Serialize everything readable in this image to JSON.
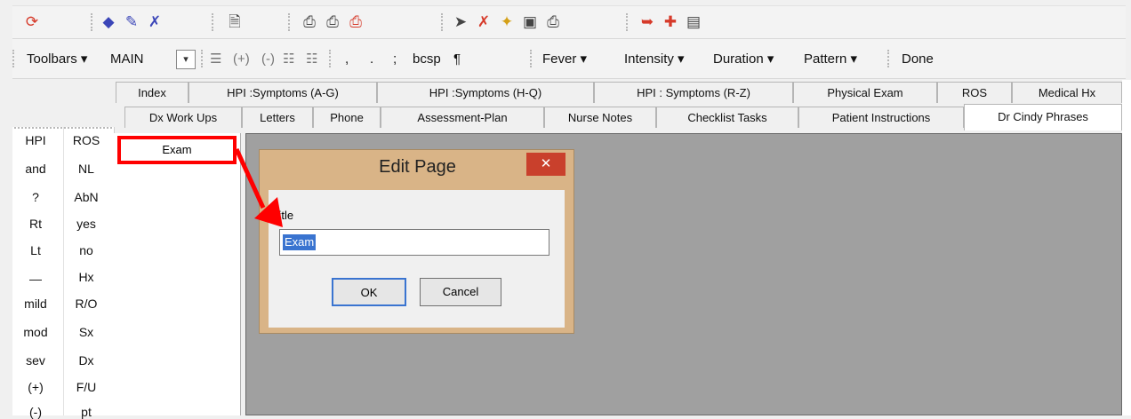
{
  "toolbar1": {
    "icons": [
      "refresh-icon",
      "bookmark-icon",
      "book-icon",
      "erase-icon",
      "document-icon",
      "print-icon",
      "print-preview-icon",
      "print-setup-icon",
      "send-icon",
      "stop-icon",
      "star-icon",
      "config-icon",
      "printer-icon",
      "export-icon",
      "add-record-icon",
      "merge-icon"
    ]
  },
  "toolbar2": {
    "toolbars_label": "Toolbars ▾",
    "toolbars_value": "MAIN",
    "combo_arrow": "▾",
    "list_icon": "☰",
    "plus": "(+)",
    "minus": "(-)",
    "bullet_icon": "☷",
    "number_icon": "☷",
    "comma": ",",
    "period": ".",
    "semicolon": ";",
    "bcsp": "bcsp",
    "pilcrow": "¶",
    "fever": "Fever ▾",
    "intensity": "Intensity ▾",
    "duration": "Duration ▾",
    "pattern": "Pattern ▾",
    "done": "Done"
  },
  "tabs_row1": [
    "Index",
    "HPI :Symptoms (A-G)",
    "HPI :Symptoms (H-Q)",
    "HPI : Symptoms (R-Z)",
    "Physical Exam",
    "ROS",
    "Medical Hx"
  ],
  "tabs_row2": [
    "Dx Work Ups",
    "Letters",
    "Phone",
    "Assessment-Plan",
    "Nurse Notes",
    "Checklist Tasks",
    "Patient Instructions",
    "Dr Cindy Phrases"
  ],
  "phrases_col1": [
    "HPI",
    "and",
    "?",
    "Rt",
    "Lt",
    "—",
    "mild",
    "mod",
    "sev",
    "(+)",
    "(-)"
  ],
  "phrases_col2": [
    "ROS",
    "NL",
    "AbN",
    "yes",
    "no",
    "Hx",
    "R/O",
    "Sx",
    "Dx",
    "F/U",
    "pt"
  ],
  "pages": {
    "selected": "Exam"
  },
  "dialog": {
    "title": "Edit Page",
    "close": "✕",
    "field_label": "Title",
    "field_value": "Exam",
    "ok": "OK",
    "cancel": "Cancel"
  },
  "colors": {
    "highlight": "#ff0000",
    "dialog_frame": "#d9b487",
    "close": "#c9402c",
    "selection": "#3a74d0"
  }
}
